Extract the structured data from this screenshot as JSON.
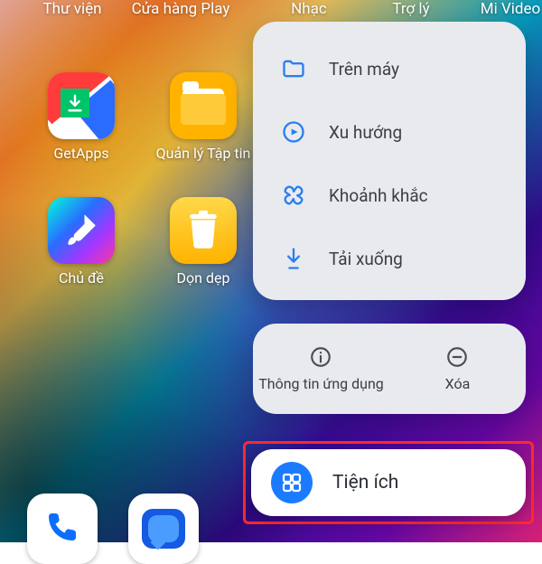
{
  "top_labels": {
    "library": "Thư viện",
    "play_store": "Cửa hàng Play",
    "music": "Nhạc",
    "assistant": "Trợ lý",
    "mivideo": "Mi Video"
  },
  "apps": {
    "getapps": "GetApps",
    "filemanager": "Quản lý Tập tin",
    "themes": "Chủ đề",
    "cleaner": "Dọn dẹp"
  },
  "menu": {
    "local": "Trên máy",
    "trending": "Xu hướng",
    "moments": "Khoảnh khắc",
    "downloads": "Tải xuống"
  },
  "actions": {
    "info": "Thông tin ứng dụng",
    "remove": "Xóa"
  },
  "widgets": {
    "label": "Tiện ích"
  }
}
